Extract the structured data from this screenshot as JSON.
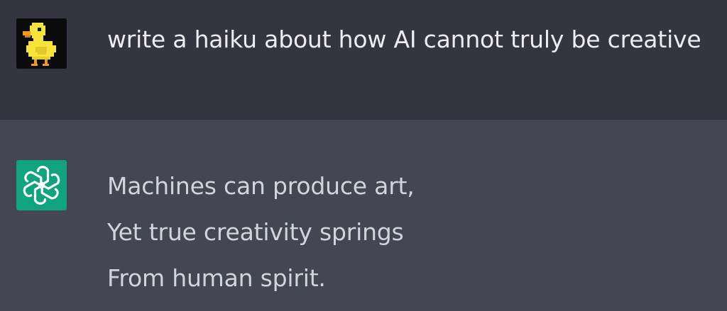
{
  "conversation": {
    "user_message": {
      "avatar_icon": "pixel-duck-icon",
      "text": "write a haiku about how AI cannot truly be creative"
    },
    "assistant_message": {
      "avatar_icon": "openai-logo-icon",
      "lines": [
        "Machines can produce art,",
        "Yet true creativity springs",
        "From human spirit."
      ]
    }
  },
  "colors": {
    "user_bg": "#343541",
    "assistant_bg": "#444654",
    "assistant_avatar": "#10a37f",
    "duck_yellow": "#f7e43a"
  }
}
